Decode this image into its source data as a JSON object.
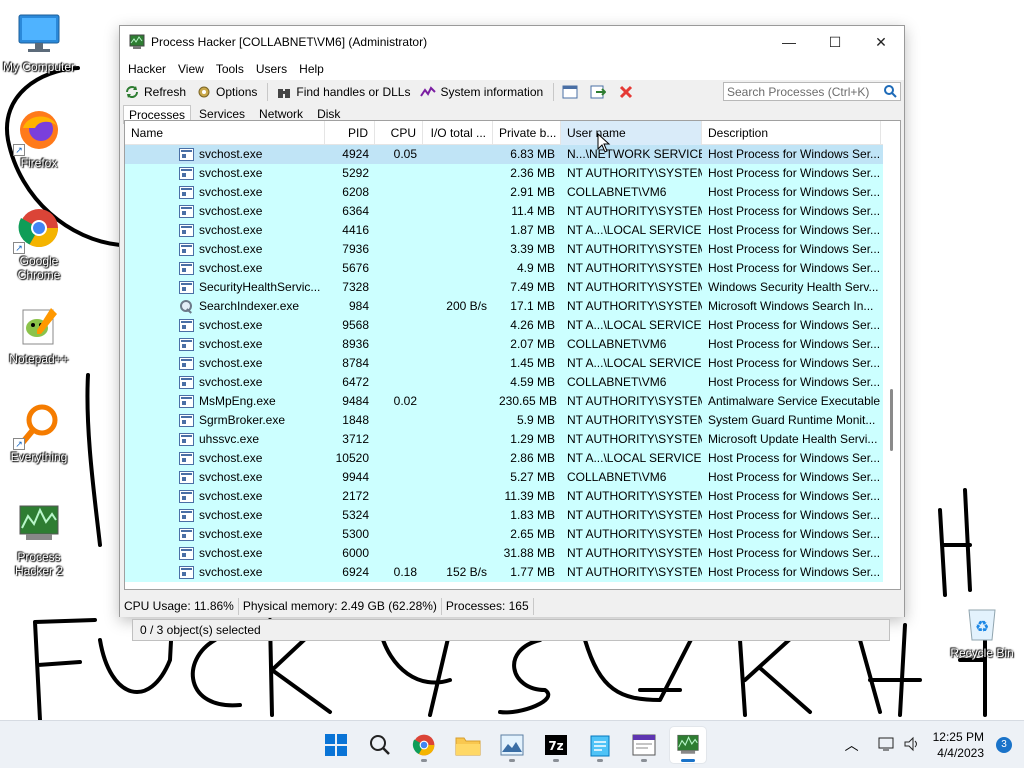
{
  "desktop": {
    "icons": [
      {
        "label": "My Computer",
        "icon": "monitor-icon"
      },
      {
        "label": "Firefox",
        "icon": "firefox-icon"
      },
      {
        "label": "Google Chrome",
        "icon": "chrome-icon"
      },
      {
        "label": "Notepad++",
        "icon": "notepadpp-icon"
      },
      {
        "label": "Everything",
        "icon": "everything-search-icon"
      },
      {
        "label": "Process Hacker 2",
        "icon": "process-hacker-icon"
      }
    ],
    "recycle_bin": {
      "label": "Recycle Bin",
      "icon": "recycle-bin-icon"
    }
  },
  "window": {
    "title": "Process Hacker [COLLABNET\\VM6] (Administrator)",
    "minimize": "—",
    "maximize": "☐",
    "close": "✕"
  },
  "menu": [
    "Hacker",
    "View",
    "Tools",
    "Users",
    "Help"
  ],
  "toolbar": {
    "refresh": "Refresh",
    "options": "Options",
    "find_handles": "Find handles or DLLs",
    "system_info": "System information",
    "search_placeholder": "Search Processes (Ctrl+K)"
  },
  "tabs": [
    "Processes",
    "Services",
    "Network",
    "Disk"
  ],
  "columns": [
    "Name",
    "PID",
    "CPU",
    "I/O total ...",
    "Private b...",
    "User name",
    "Description"
  ],
  "rows": [
    {
      "name": "svchost.exe",
      "pid": "4924",
      "cpu": "0.05",
      "io": "",
      "priv": "6.83 MB",
      "user": "N...\\NETWORK SERVICE",
      "desc": "Host Process for Windows Ser...",
      "icon": "window-app-icon"
    },
    {
      "name": "svchost.exe",
      "pid": "5292",
      "cpu": "",
      "io": "",
      "priv": "2.36 MB",
      "user": "NT AUTHORITY\\SYSTEM",
      "desc": "Host Process for Windows Ser...",
      "icon": "window-app-icon"
    },
    {
      "name": "svchost.exe",
      "pid": "6208",
      "cpu": "",
      "io": "",
      "priv": "2.91 MB",
      "user": "COLLABNET\\VM6",
      "desc": "Host Process for Windows Ser...",
      "icon": "window-app-icon"
    },
    {
      "name": "svchost.exe",
      "pid": "6364",
      "cpu": "",
      "io": "",
      "priv": "11.4 MB",
      "user": "NT AUTHORITY\\SYSTEM",
      "desc": "Host Process for Windows Ser...",
      "icon": "window-app-icon"
    },
    {
      "name": "svchost.exe",
      "pid": "4416",
      "cpu": "",
      "io": "",
      "priv": "1.87 MB",
      "user": "NT A...\\LOCAL SERVICE",
      "desc": "Host Process for Windows Ser...",
      "icon": "window-app-icon"
    },
    {
      "name": "svchost.exe",
      "pid": "7936",
      "cpu": "",
      "io": "",
      "priv": "3.39 MB",
      "user": "NT AUTHORITY\\SYSTEM",
      "desc": "Host Process for Windows Ser...",
      "icon": "window-app-icon"
    },
    {
      "name": "svchost.exe",
      "pid": "5676",
      "cpu": "",
      "io": "",
      "priv": "4.9 MB",
      "user": "NT AUTHORITY\\SYSTEM",
      "desc": "Host Process for Windows Ser...",
      "icon": "window-app-icon"
    },
    {
      "name": "SecurityHealthServic...",
      "pid": "7328",
      "cpu": "",
      "io": "",
      "priv": "7.49 MB",
      "user": "NT AUTHORITY\\SYSTEM",
      "desc": "Windows Security Health Serv...",
      "icon": "window-app-icon"
    },
    {
      "name": "SearchIndexer.exe",
      "pid": "984",
      "cpu": "",
      "io": "200 B/s",
      "priv": "17.1 MB",
      "user": "NT AUTHORITY\\SYSTEM",
      "desc": "Microsoft Windows Search In...",
      "icon": "search-indexer-icon"
    },
    {
      "name": "svchost.exe",
      "pid": "9568",
      "cpu": "",
      "io": "",
      "priv": "4.26 MB",
      "user": "NT A...\\LOCAL SERVICE",
      "desc": "Host Process for Windows Ser...",
      "icon": "window-app-icon"
    },
    {
      "name": "svchost.exe",
      "pid": "8936",
      "cpu": "",
      "io": "",
      "priv": "2.07 MB",
      "user": "COLLABNET\\VM6",
      "desc": "Host Process for Windows Ser...",
      "icon": "window-app-icon"
    },
    {
      "name": "svchost.exe",
      "pid": "8784",
      "cpu": "",
      "io": "",
      "priv": "1.45 MB",
      "user": "NT A...\\LOCAL SERVICE",
      "desc": "Host Process for Windows Ser...",
      "icon": "window-app-icon"
    },
    {
      "name": "svchost.exe",
      "pid": "6472",
      "cpu": "",
      "io": "",
      "priv": "4.59 MB",
      "user": "COLLABNET\\VM6",
      "desc": "Host Process for Windows Ser...",
      "icon": "window-app-icon"
    },
    {
      "name": "MsMpEng.exe",
      "pid": "9484",
      "cpu": "0.02",
      "io": "",
      "priv": "230.65 MB",
      "user": "NT AUTHORITY\\SYSTEM",
      "desc": "Antimalware Service Executable",
      "icon": "window-app-icon"
    },
    {
      "name": "SgrmBroker.exe",
      "pid": "1848",
      "cpu": "",
      "io": "",
      "priv": "5.9 MB",
      "user": "NT AUTHORITY\\SYSTEM",
      "desc": "System Guard Runtime Monit...",
      "icon": "window-app-icon"
    },
    {
      "name": "uhssvc.exe",
      "pid": "3712",
      "cpu": "",
      "io": "",
      "priv": "1.29 MB",
      "user": "NT AUTHORITY\\SYSTEM",
      "desc": "Microsoft Update Health Servi...",
      "icon": "window-app-icon"
    },
    {
      "name": "svchost.exe",
      "pid": "10520",
      "cpu": "",
      "io": "",
      "priv": "2.86 MB",
      "user": "NT A...\\LOCAL SERVICE",
      "desc": "Host Process for Windows Ser...",
      "icon": "window-app-icon"
    },
    {
      "name": "svchost.exe",
      "pid": "9944",
      "cpu": "",
      "io": "",
      "priv": "5.27 MB",
      "user": "COLLABNET\\VM6",
      "desc": "Host Process for Windows Ser...",
      "icon": "window-app-icon"
    },
    {
      "name": "svchost.exe",
      "pid": "2172",
      "cpu": "",
      "io": "",
      "priv": "11.39 MB",
      "user": "NT AUTHORITY\\SYSTEM",
      "desc": "Host Process for Windows Ser...",
      "icon": "window-app-icon"
    },
    {
      "name": "svchost.exe",
      "pid": "5324",
      "cpu": "",
      "io": "",
      "priv": "1.83 MB",
      "user": "NT AUTHORITY\\SYSTEM",
      "desc": "Host Process for Windows Ser...",
      "icon": "window-app-icon"
    },
    {
      "name": "svchost.exe",
      "pid": "5300",
      "cpu": "",
      "io": "",
      "priv": "2.65 MB",
      "user": "NT AUTHORITY\\SYSTEM",
      "desc": "Host Process for Windows Ser...",
      "icon": "window-app-icon"
    },
    {
      "name": "svchost.exe",
      "pid": "6000",
      "cpu": "",
      "io": "",
      "priv": "31.88 MB",
      "user": "NT AUTHORITY\\SYSTEM",
      "desc": "Host Process for Windows Ser...",
      "icon": "window-app-icon"
    },
    {
      "name": "svchost.exe",
      "pid": "6924",
      "cpu": "0.18",
      "io": "152 B/s",
      "priv": "1.77 MB",
      "user": "NT AUTHORITY\\SYSTEM",
      "desc": "Host Process for Windows Ser...",
      "icon": "window-app-icon"
    }
  ],
  "statusbar": {
    "cpu": "CPU Usage: 11.86%",
    "memory": "Physical memory: 2.49 GB (62.28%)",
    "processes": "Processes: 165"
  },
  "selection_text": "0 / 3 object(s) selected",
  "taskbar": {
    "apps": [
      "start-icon",
      "search-icon",
      "chrome-icon",
      "file-explorer-icon",
      "photos-icon",
      "7zip-icon",
      "notepad-icon",
      "terminal-window-icon",
      "process-hacker-icon"
    ],
    "time": "12:25 PM",
    "date": "4/4/2023",
    "notifications": "3"
  },
  "colors": {
    "row_bg": "#ccffff",
    "selected_row_bg": "#c0e4f6",
    "accent": "#1a73c9"
  }
}
